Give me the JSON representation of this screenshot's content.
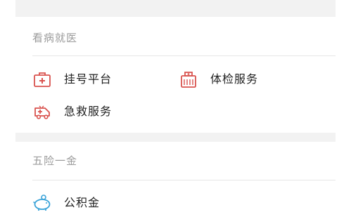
{
  "sections": [
    {
      "title": "看病就医",
      "items": [
        {
          "label": "挂号平台",
          "icon": "medical-kit-icon"
        },
        {
          "label": "体检服务",
          "icon": "health-check-icon"
        },
        {
          "label": "急救服务",
          "icon": "ambulance-icon"
        }
      ]
    },
    {
      "title": "五险一金",
      "items": [
        {
          "label": "公积金",
          "icon": "piggy-bank-icon"
        }
      ]
    }
  ],
  "colors": {
    "medical_icon": "#d9534f",
    "fund_icon": "#3aa3d8",
    "section_title": "#9b9b9b",
    "label": "#222222",
    "gap_background": "#f2f2f2"
  }
}
